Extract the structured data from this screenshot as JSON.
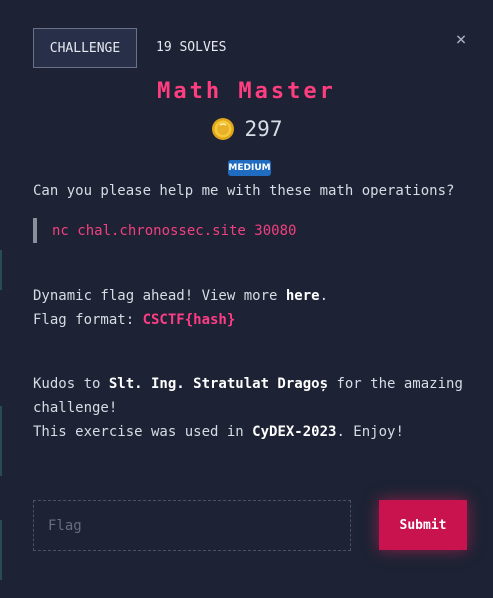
{
  "tabs": {
    "challenge": "CHALLENGE",
    "solves": "19 SOLVES"
  },
  "close_glyph": "×",
  "challenge": {
    "title": "Math Master",
    "points": "297",
    "difficulty": "MEDIUM"
  },
  "description": {
    "intro": "Can you please help me with these math operations?",
    "command": "nc chal.chronossec.site 30080",
    "dynamic_prefix": "Dynamic flag ahead! View more ",
    "dynamic_link": "here",
    "dynamic_suffix": ".",
    "format_prefix": "Flag format: ",
    "format_value": "CSCTF{hash}",
    "kudos_prefix": "Kudos to ",
    "kudos_name": "Slt. Ing. Stratulat Dragoș",
    "kudos_suffix": " for the amazing",
    "kudos_line2": "challenge!",
    "cydex_prefix": "This exercise was used in ",
    "cydex_name": "CyDEX-2023",
    "cydex_suffix": ". Enjoy!"
  },
  "form": {
    "flag_placeholder": "Flag",
    "flag_value": "",
    "submit_label": "Submit"
  },
  "colors": {
    "accent": "#ff3d7f",
    "badge": "#1f6cc0",
    "submit": "#c8134f",
    "background": "#1d2334"
  },
  "icons": {
    "close": "close-icon",
    "coin": "coin-icon"
  }
}
